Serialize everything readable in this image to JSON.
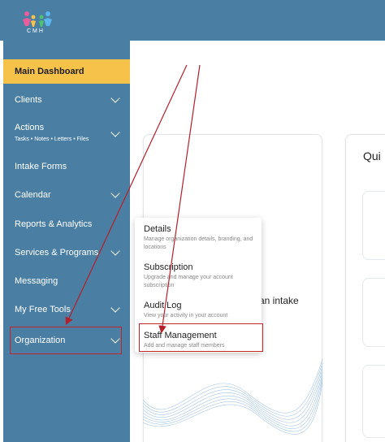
{
  "logo": {
    "text": "CMH",
    "icon": "family-logo-icon"
  },
  "sidebar": {
    "items": [
      {
        "label": "Main Dashboard",
        "active": true,
        "chevron": false
      },
      {
        "label": "Clients",
        "chevron": true
      },
      {
        "label": "Actions",
        "chevron": true
      },
      {
        "label": "Intake Forms",
        "chevron": false
      },
      {
        "label": "Calendar",
        "chevron": true
      },
      {
        "label": "Reports & Analytics",
        "chevron": false
      },
      {
        "label": "Services & Programs",
        "chevron": true
      },
      {
        "label": "Messaging",
        "chevron": false
      },
      {
        "label": "My Free Tools",
        "chevron": true
      },
      {
        "label": "Organization",
        "chevron": true
      }
    ],
    "actions_sub": "Tasks • Notes • Letters • Files"
  },
  "main": {
    "quick_title": "Qui",
    "intake_text": "l an intake"
  },
  "dropdown": {
    "items": [
      {
        "title": "Details",
        "desc": "Manage organization details, branding, and locations"
      },
      {
        "title": "Subscription",
        "desc": "Upgrade and manage your account subscription"
      },
      {
        "title": "Audit Log",
        "desc": "View your activity in your account"
      },
      {
        "title": "Staff Management",
        "desc": "Add and manage staff members"
      }
    ]
  },
  "colors": {
    "sidebar": "#4a7fa3",
    "active": "#f6c24a",
    "highlight": "#c0272d"
  }
}
